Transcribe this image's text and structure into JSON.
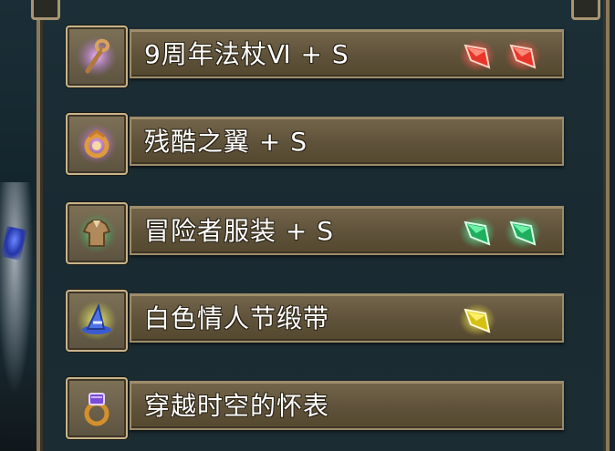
{
  "items": [
    {
      "name": "9周年法杖Ⅵ + S",
      "icon": "staff-icon",
      "gems": [
        {
          "color": "#ff3b32",
          "icon": "red-crystal-icon"
        },
        {
          "color": "#ff3b32",
          "icon": "red-crystal-icon"
        }
      ]
    },
    {
      "name": "残酷之翼 + S",
      "icon": "wing-ring-icon",
      "gems": []
    },
    {
      "name": "冒险者服装 + S",
      "icon": "armor-icon",
      "gems": [
        {
          "color": "#2fd07a",
          "icon": "green-crystal-icon"
        },
        {
          "color": "#2fd07a",
          "icon": "green-crystal-icon"
        }
      ]
    },
    {
      "name": "白色情人节缎带",
      "icon": "witch-hat-icon",
      "gems": [
        {
          "color": "#e8d81a",
          "icon": "yellow-crystal-icon"
        }
      ]
    },
    {
      "name": "穿越时空的怀表",
      "icon": "jeweled-ring-icon",
      "gems": []
    }
  ]
}
